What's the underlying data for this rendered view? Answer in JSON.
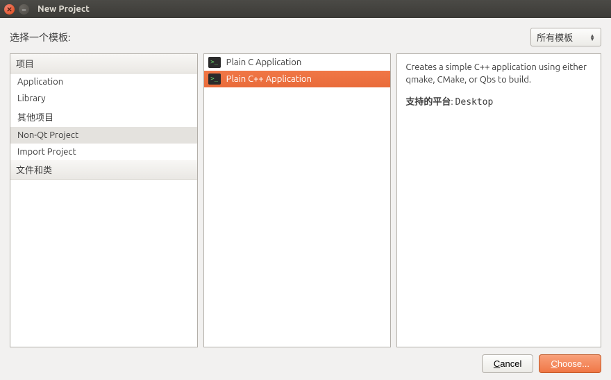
{
  "window": {
    "title": "New Project"
  },
  "top": {
    "choose_template_label": "选择一个模板:",
    "filter_dropdown": "所有模板"
  },
  "categories": {
    "header1": "项目",
    "items": [
      "Application",
      "Library",
      "其他项目",
      "Non-Qt Project",
      "Import Project"
    ],
    "selected_index": 3,
    "header2": "文件和类"
  },
  "templates": {
    "items": [
      {
        "label": "Plain C Application"
      },
      {
        "label": "Plain C++ Application"
      }
    ],
    "selected_index": 1
  },
  "description": {
    "text": "Creates a simple C++ application using either qmake, CMake, or Qbs to build.",
    "platforms_label": "支持的平台",
    "platforms_value": "Desktop"
  },
  "buttons": {
    "cancel": "Cancel",
    "choose": "Choose..."
  }
}
